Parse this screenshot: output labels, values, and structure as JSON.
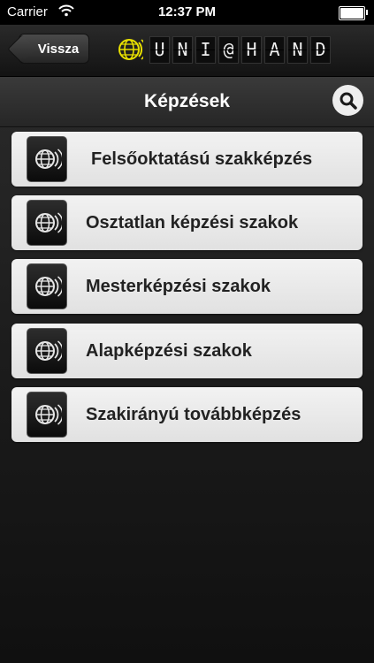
{
  "status_bar": {
    "carrier": "Carrier",
    "time": "12:37 PM"
  },
  "nav": {
    "back_label": "Vissza",
    "logo_letters": [
      "U",
      "N",
      "I",
      "@",
      "H",
      "A",
      "N",
      "D"
    ],
    "logo_accent_color": "#e8e000"
  },
  "title": {
    "text": "Képzések"
  },
  "menu": {
    "items": [
      {
        "label": "Felsőoktatású szakképzés",
        "icon": "globe-icon"
      },
      {
        "label": "Osztatlan képzési szakok",
        "icon": "globe-icon"
      },
      {
        "label": "Mesterképzési szakok",
        "icon": "globe-icon"
      },
      {
        "label": "Alapképzési szakok",
        "icon": "globe-icon"
      },
      {
        "label": "Szakirányú továbbképzés",
        "icon": "globe-icon"
      }
    ]
  }
}
